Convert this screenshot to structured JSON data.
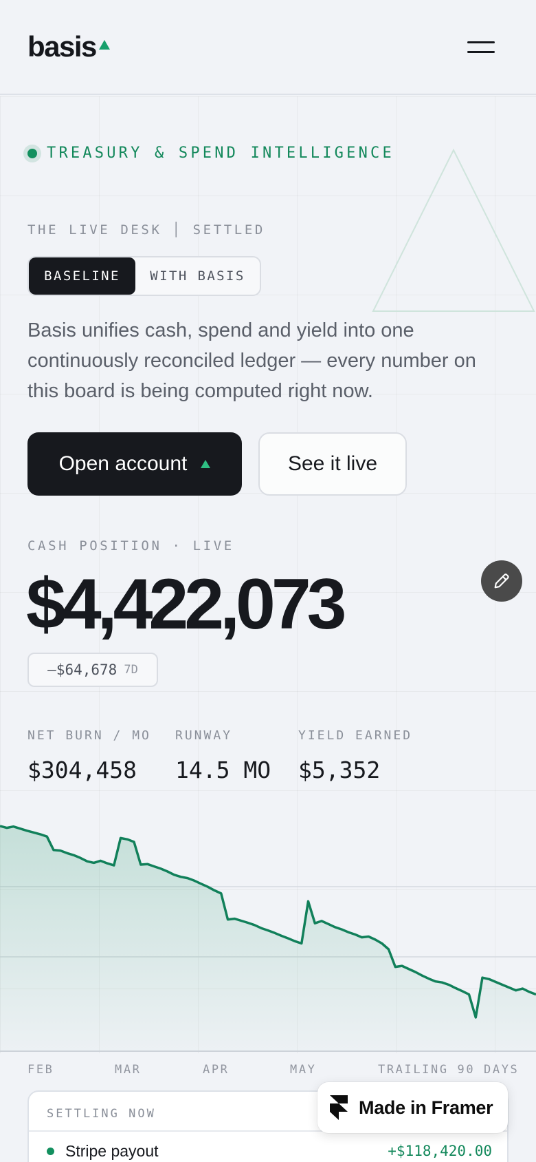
{
  "header": {
    "logo_text": "basis",
    "menu_icon": "hamburger-menu-icon"
  },
  "hero": {
    "eyebrow": "TREASURY & SPEND INTELLIGENCE",
    "desk_label": "THE LIVE DESK │ SETTLED",
    "toggle": {
      "options": [
        "BASELINE",
        "WITH BASIS"
      ],
      "active": "BASELINE"
    },
    "lead": "Basis unifies cash, spend and yield into one continuously reconciled ledger — every number on this board is being computed right now.",
    "primary_cta": "Open account",
    "secondary_cta": "See it live"
  },
  "cash": {
    "label": "CASH POSITION · LIVE",
    "value": "$4,422,073",
    "delta_value": "–$64,678",
    "delta_period": "7D"
  },
  "stats": [
    {
      "label": "NET BURN / MO",
      "value": "$304,458"
    },
    {
      "label": "RUNWAY",
      "value": "14.5 MO"
    },
    {
      "label": "YIELD EARNED",
      "value": "$5,352"
    }
  ],
  "chart_data": {
    "type": "area",
    "title": "",
    "xlabel": "",
    "ylabel": "",
    "categories": [
      "FEB",
      "MAR",
      "APR",
      "MAY"
    ],
    "range_label": "TRAILING 90 DAYS",
    "series": [
      {
        "values": [
          100,
          99.3,
          99.8,
          99.0,
          98.2,
          97.5,
          96.8,
          95.9,
          90.6,
          90.4,
          89.4,
          88.6,
          87.5,
          86.2,
          85.6,
          86.4,
          85.4,
          84.6,
          95.3,
          94.8,
          93.8,
          84.9,
          85.1,
          84.2,
          83.3,
          82.2,
          80.9,
          80.1,
          79.6,
          78.6,
          77.4,
          76.2,
          74.8,
          73.6,
          63.4,
          63.7,
          62.9,
          62.1,
          61.2,
          60.0,
          59.1,
          58.1,
          57.0,
          56.0,
          54.9,
          54.0,
          70.5,
          61.9,
          62.8,
          61.6,
          60.4,
          59.5,
          58.4,
          57.5,
          56.4,
          56.7,
          55.5,
          54.0,
          51.7,
          44.8,
          45.2,
          44.0,
          42.8,
          41.4,
          40.2,
          39.1,
          38.7,
          37.8,
          36.5,
          35.3,
          34.0,
          25.0,
          40.6,
          40.0,
          38.9,
          37.8,
          36.7,
          35.6,
          36.3,
          35.0,
          34.0
        ],
        "color": "#11805a"
      }
    ]
  },
  "settling": {
    "title": "SETTLING NOW",
    "rows": [
      {
        "name": "Stripe payout",
        "amount": "+$118,420.00"
      }
    ]
  },
  "badge": {
    "text": "Made in Framer"
  }
}
